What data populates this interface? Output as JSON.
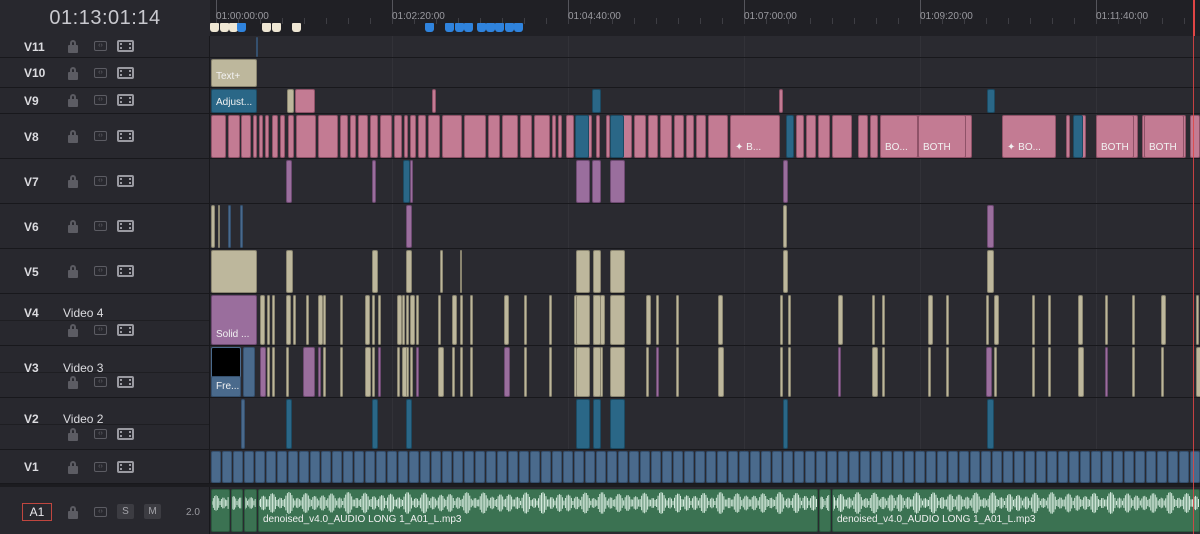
{
  "timecode": "01:13:01:14",
  "ruler": {
    "ticks": [
      "01:00:00:00",
      "01:02:20:00",
      "01:04:40:00",
      "01:07:00:00",
      "01:09:20:00",
      "01:11:40:00"
    ]
  },
  "video_tracks": [
    {
      "id": "V11",
      "name": ""
    },
    {
      "id": "V10",
      "name": ""
    },
    {
      "id": "V9",
      "name": ""
    },
    {
      "id": "V8",
      "name": ""
    },
    {
      "id": "V7",
      "name": ""
    },
    {
      "id": "V6",
      "name": ""
    },
    {
      "id": "V5",
      "name": ""
    },
    {
      "id": "V4",
      "name": "Video 4"
    },
    {
      "id": "V3",
      "name": "Video 3"
    },
    {
      "id": "V2",
      "name": "Video 2"
    },
    {
      "id": "V1",
      "name": ""
    }
  ],
  "clip_labels": {
    "text_plus": "Text+",
    "adjust": "Adjust...",
    "solid": "Solid ...",
    "fre": "Fre...",
    "v8_b": "✦ B...",
    "v8_bo1": "BO...",
    "v8_both1": "BOTH",
    "v8_bo2": "✦ BO...",
    "v8_both2": "BOTH",
    "v8_both3": "BOTH"
  },
  "audio_track": {
    "id": "A1",
    "solo_label": "S",
    "mute_label": "M",
    "channel": "2.0",
    "clips": [
      {
        "name": "denoised_v4.0_AUDIO LONG 1_A01_L.mp3"
      },
      {
        "name": "denoised_v4.0_AUDIO LONG 1_A01_L.mp3"
      }
    ]
  },
  "colors": {
    "pink": "#c37b93",
    "purple": "#9a6e9d",
    "teal": "#2a6787",
    "beige": "#bdb79c",
    "steel": "#4a6a8c",
    "audio": "#3b7252",
    "playhead": "#e04545"
  },
  "icons": [
    "lock-icon",
    "code-icon",
    "film-icon"
  ]
}
